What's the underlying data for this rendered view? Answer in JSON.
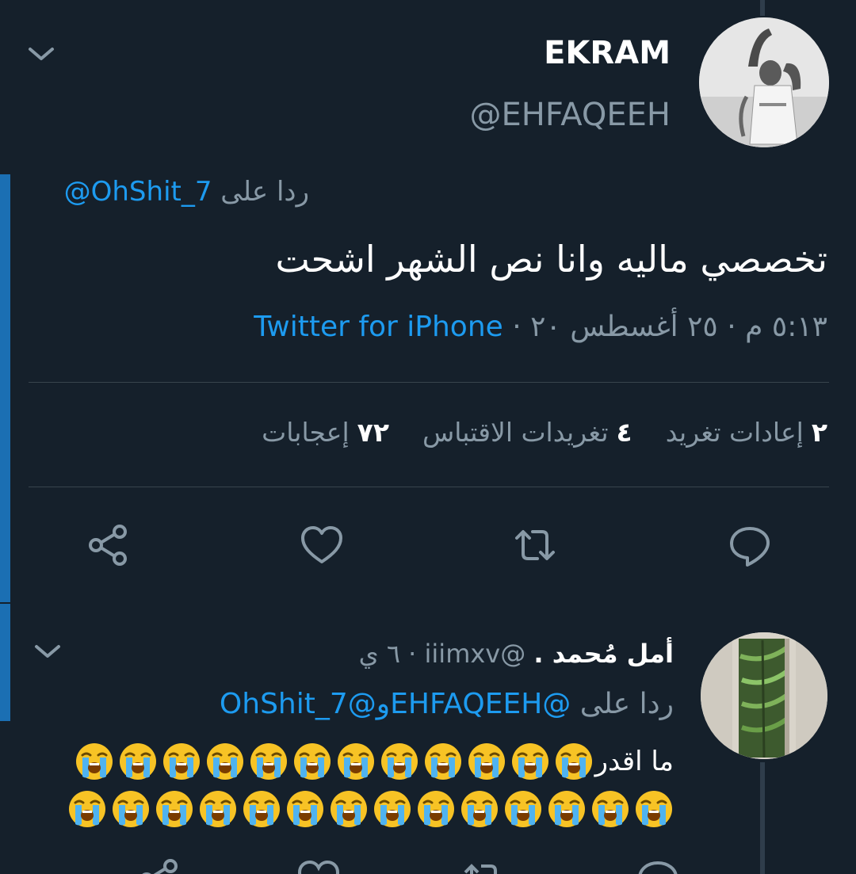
{
  "tweet": {
    "author_name": "EKRAM",
    "author_handle": "@EHFAQEEH",
    "reply_prefix": "ردا على",
    "reply_to": "@OhShit_7",
    "text": "تخصصي ماليه وانا نص الشهر اشحت",
    "time": "٥:١٣ م",
    "date": "٢٥ أغسطس ٢٠",
    "separator": "·",
    "source": "Twitter for iPhone",
    "stats": {
      "retweets_count": "٢",
      "retweets_label": "إعادات تغريد",
      "quotes_count": "٤",
      "quotes_label": "تغريدات الاقتباس",
      "likes_count": "٧٢",
      "likes_label": "إعجابات"
    },
    "actions": [
      "reply-icon",
      "retweet-icon",
      "like-icon",
      "share-icon"
    ]
  },
  "reply": {
    "author_name": "أمل مُحمد .",
    "author_handle": "@iiimxv",
    "separator": "·",
    "age": "٦ ي",
    "reply_prefix": "ردا على",
    "reply_to_1": "@EHFAQEEH",
    "reply_joiner": "و",
    "reply_to_2": "@OhShit_7",
    "text": "ما اقدر",
    "emoji_line1_count": 12,
    "emoji_line2_count": 14,
    "emoji_name": "loudly-crying-face"
  },
  "colors": {
    "background": "#15202b",
    "accent": "#1d9bf0",
    "muted": "#8899a6",
    "divider": "#38444d",
    "thread_bar": "#1b6fb3"
  }
}
